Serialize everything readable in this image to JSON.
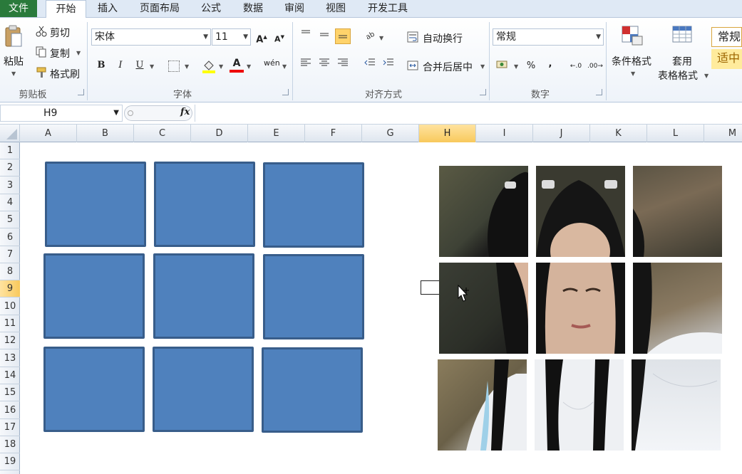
{
  "tabs": [
    {
      "label": "文件",
      "kind": "file"
    },
    {
      "label": "开始",
      "kind": "active"
    },
    {
      "label": "插入"
    },
    {
      "label": "页面布局"
    },
    {
      "label": "公式"
    },
    {
      "label": "数据"
    },
    {
      "label": "审阅"
    },
    {
      "label": "视图"
    },
    {
      "label": "开发工具"
    }
  ],
  "ribbon": {
    "clipboard": {
      "label": "剪贴板",
      "paste": "粘贴",
      "cut": "剪切",
      "copy": "复制",
      "format_painter": "格式刷"
    },
    "font": {
      "label": "字体",
      "name": "宋体",
      "size": "11",
      "grow": "A",
      "shrink": "A",
      "bold": "B",
      "italic": "I",
      "underline": "U",
      "font_color_letter": "A",
      "phonetic": "wén"
    },
    "alignment": {
      "label": "对齐方式",
      "wrap": "自动换行",
      "merge": "合并后居中"
    },
    "number": {
      "label": "数字",
      "format": "常规",
      "percent": "%",
      "comma": ","
    },
    "styles": {
      "conditional": "条件格式",
      "table_format_1": "套用",
      "table_format_2": "表格格式",
      "normal_style": "常规",
      "neutral_style": "适中"
    }
  },
  "formula_bar": {
    "name_box": "H9",
    "fx": "fx",
    "value": ""
  },
  "sheet": {
    "columns": [
      "A",
      "B",
      "C",
      "D",
      "E",
      "F",
      "G",
      "H",
      "I",
      "J",
      "K",
      "L",
      "M"
    ],
    "rows": [
      "1",
      "2",
      "3",
      "4",
      "5",
      "6",
      "7",
      "8",
      "9",
      "10",
      "11",
      "12",
      "13",
      "14",
      "15",
      "16",
      "17",
      "18",
      "19"
    ],
    "selected_column": "H",
    "selected_row": "9"
  },
  "colors": {
    "shape_fill": "#4f81bd",
    "shape_border": "#385d8a",
    "file_tab": "#2a7a3b",
    "selection": "#f8c95c"
  }
}
